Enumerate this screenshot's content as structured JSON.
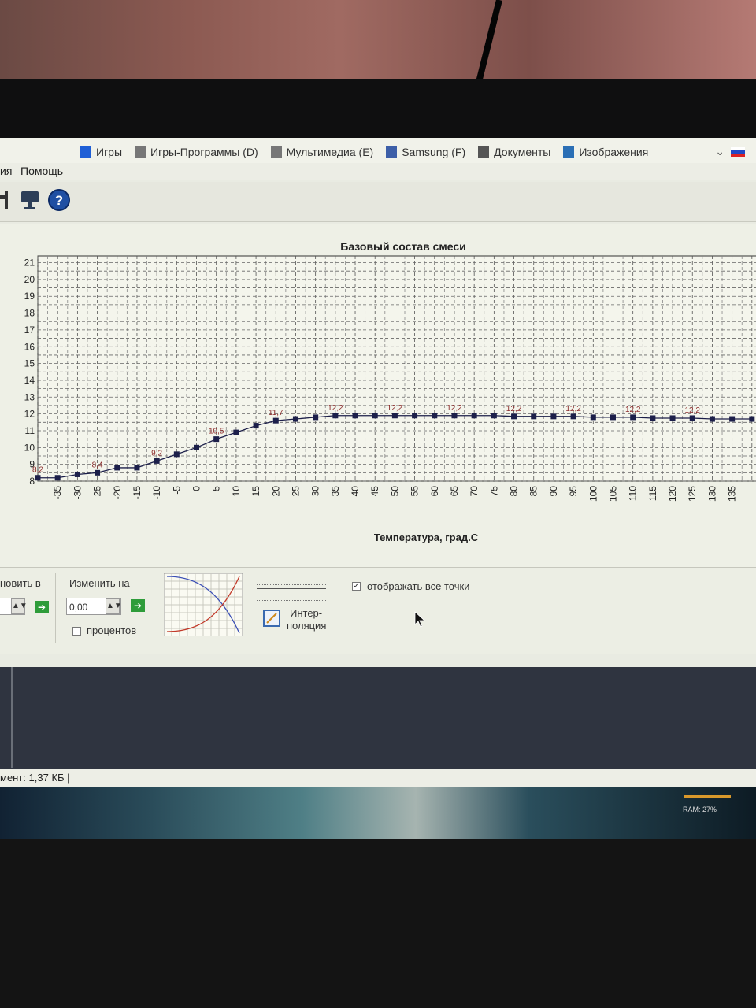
{
  "bookmarks": [
    {
      "icon": "bookmark-blue-icon",
      "label": "Игры"
    },
    {
      "icon": "drive-icon",
      "label": "Игры-Программы (D)"
    },
    {
      "icon": "drive-icon",
      "label": "Мультимедиа (E)"
    },
    {
      "icon": "drive-usb-icon",
      "label": "Samsung (F)"
    },
    {
      "icon": "document-icon",
      "label": "Документы"
    },
    {
      "icon": "image-icon",
      "label": "Изображения"
    }
  ],
  "menu": {
    "partial": "ия",
    "help": "Помощь"
  },
  "chart_data": {
    "type": "line",
    "title": "Базовый состав смеси",
    "xlabel": "Температура, град.С",
    "ylabel": "",
    "ylim": [
      8,
      21
    ],
    "yticks": [
      8,
      9,
      10,
      11,
      12,
      13,
      14,
      15,
      16,
      17,
      18,
      19,
      20,
      21
    ],
    "xticks": [
      -35,
      -30,
      -25,
      -20,
      -15,
      -10,
      -5,
      0,
      5,
      10,
      15,
      20,
      25,
      30,
      35,
      40,
      45,
      50,
      55,
      60,
      65,
      70,
      75,
      80,
      85,
      90,
      95,
      100,
      105,
      110,
      115,
      120,
      125,
      130,
      135
    ],
    "x": [
      -40,
      -35,
      -30,
      -25,
      -20,
      -15,
      -10,
      -5,
      0,
      5,
      10,
      15,
      20,
      25,
      30,
      35,
      40,
      45,
      50,
      55,
      60,
      65,
      70,
      75,
      80,
      85,
      90,
      95,
      100,
      105,
      110,
      115,
      120,
      125,
      130,
      135,
      140
    ],
    "y": [
      8.2,
      8.2,
      8.4,
      8.5,
      8.8,
      8.8,
      9.2,
      9.6,
      10.0,
      10.5,
      10.9,
      11.3,
      11.6,
      11.7,
      11.8,
      11.9,
      11.9,
      11.9,
      11.9,
      11.9,
      11.9,
      11.9,
      11.9,
      11.9,
      11.85,
      11.85,
      11.85,
      11.85,
      11.8,
      11.8,
      11.8,
      11.75,
      11.75,
      11.75,
      11.7,
      11.7,
      11.7
    ],
    "data_labels": [
      {
        "x": -40,
        "text": "8,2"
      },
      {
        "x": -25,
        "text": "8,4"
      },
      {
        "x": -10,
        "text": "9,2"
      },
      {
        "x": 5,
        "text": "10,5"
      },
      {
        "x": 20,
        "text": "11,7"
      },
      {
        "x": 35,
        "text": "12,2"
      },
      {
        "x": 50,
        "text": "12,2"
      },
      {
        "x": 65,
        "text": "12,2"
      },
      {
        "x": 80,
        "text": "12,2"
      },
      {
        "x": 95,
        "text": "12,2"
      },
      {
        "x": 110,
        "text": "12,2"
      },
      {
        "x": 125,
        "text": "12,2"
      }
    ],
    "grid": true,
    "legend": "none"
  },
  "controls": {
    "set_to_label": "новить в",
    "change_by_label": "Изменить на",
    "change_by_value": "0,00",
    "percent_label": "процентов",
    "interp_label_1": "Интер-",
    "interp_label_2": "поляция",
    "show_all_points_label": "отображать все точки"
  },
  "status": {
    "text": "мент: 1,37 КБ  |"
  },
  "taskbar": {
    "ram": "RAM: 27%"
  },
  "colors": {
    "point": "#1c1f4a",
    "line": "#1c1f4a",
    "label": "#8b2a2a",
    "go": "#2e9c3a"
  }
}
